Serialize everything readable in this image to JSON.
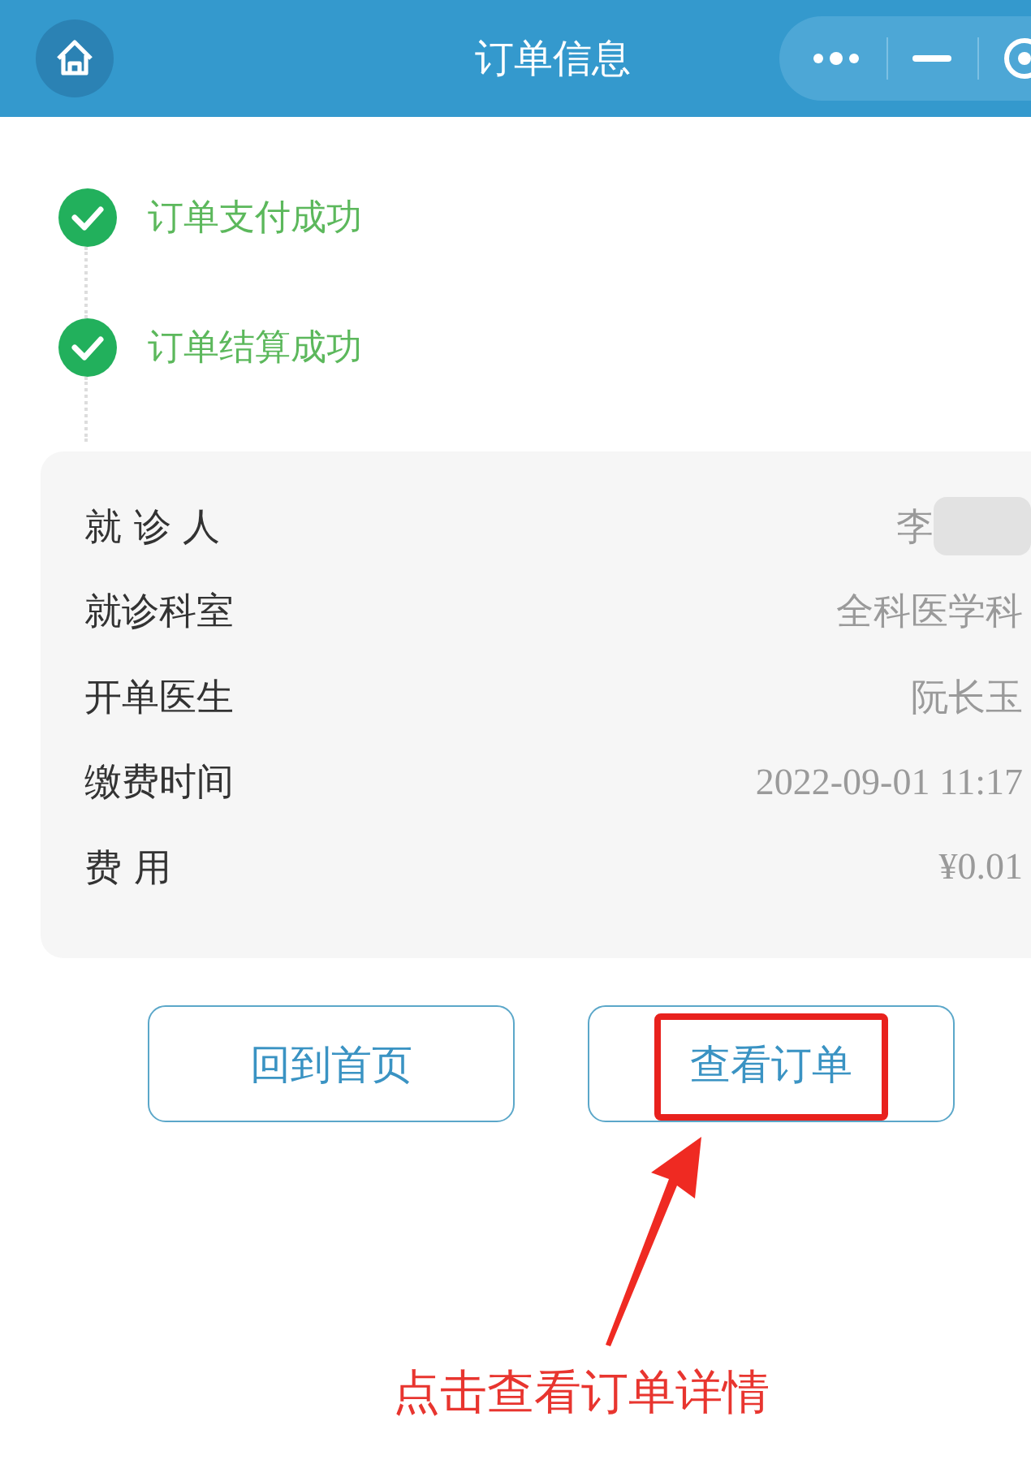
{
  "header": {
    "title": "订单信息"
  },
  "steps": [
    {
      "label": "订单支付成功",
      "done": true
    },
    {
      "label": "订单结算成功",
      "done": true
    }
  ],
  "details": [
    {
      "label": "就 诊 人",
      "value": "李",
      "redacted": true
    },
    {
      "label": "就诊科室",
      "value": "全科医学科",
      "redacted": false
    },
    {
      "label": "开单医生",
      "value": "阮长玉",
      "redacted": false
    },
    {
      "label": "缴费时间",
      "value": "2022-09-01 11:17",
      "redacted": false
    },
    {
      "label": "费 用",
      "value": "¥0.01",
      "redacted": false
    }
  ],
  "buttons": [
    {
      "label": "回到首页",
      "highlighted": false
    },
    {
      "label": "查看订单",
      "highlighted": true
    }
  ],
  "annotation": {
    "caption": "点击查看订单详情"
  }
}
